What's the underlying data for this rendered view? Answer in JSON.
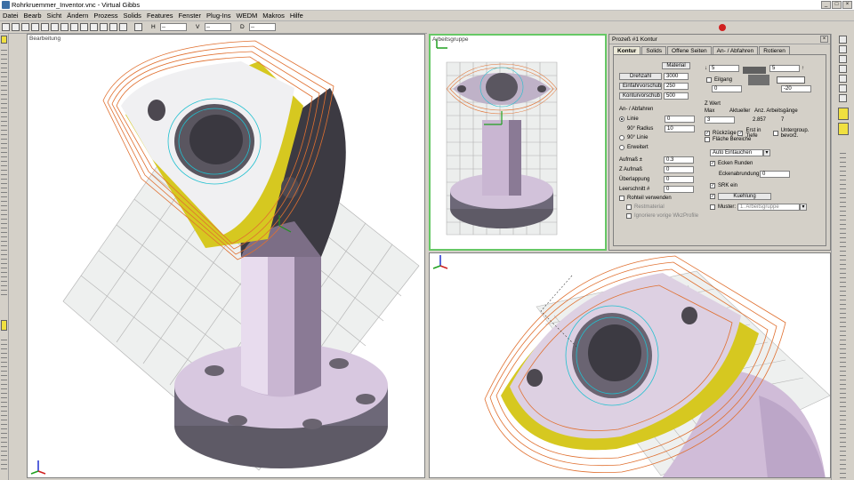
{
  "window": {
    "title": "Rohrkruemmer_Inventor.vnc - Virtual Gibbs"
  },
  "menu": [
    "Datei",
    "Bearb",
    "Sicht",
    "Ändern",
    "Prozess",
    "Solids",
    "Features",
    "Fenster",
    "Plug-Ins",
    "WEDM",
    "Makros",
    "Hilfe"
  ],
  "toolbar": {
    "coords": [
      {
        "label": "H",
        "value": "--"
      },
      {
        "label": "V",
        "value": "--"
      },
      {
        "label": "D",
        "value": "--"
      }
    ]
  },
  "viewports": {
    "main": {
      "title": "Bearbeitung"
    },
    "topright": {
      "title": "Arbeitsgruppe"
    },
    "bottomright": {
      "title": ""
    }
  },
  "dialog": {
    "title": "Prozeß #1 Kontur",
    "tabs": [
      "Kontur",
      "Solids",
      "Offene Seiten",
      "An- / Abfahren",
      "Rotieren"
    ],
    "material_button": "Material",
    "rows": [
      {
        "button": "Drehzahl",
        "value": "3000"
      },
      {
        "button": "Einfahrvorschub",
        "value": "250"
      },
      {
        "button": "Konturvorschub",
        "value": "500"
      }
    ],
    "depth_top": "5",
    "depth_top2": "5",
    "eilgang_label": "Eilgang",
    "depth_bottom": "0",
    "depth_bottom2": "-20",
    "eilgang2_value": "0",
    "an_abfahren": {
      "label": "An- / Abfahren",
      "options": [
        {
          "label": "Linie",
          "value": "0",
          "selected": true
        },
        {
          "label": "90° Radius",
          "value": "10",
          "selected": false
        },
        {
          "label": "90° Linie",
          "value": "",
          "selected": false
        },
        {
          "label": "Erweitert",
          "value": "",
          "selected": false
        }
      ]
    },
    "zwert": {
      "label": "Z Wert",
      "cols": [
        "Max",
        "Aktueller",
        "Anz. Arbeitsgänge"
      ],
      "values": [
        "3",
        "2.857",
        "7"
      ],
      "checks": [
        {
          "label": "Rückzüge",
          "checked": true
        },
        {
          "label": "Erst in Tiefe",
          "checked": true
        },
        {
          "label": "Untergroup. bevorz.",
          "checked": false
        },
        {
          "label": "Fläche Bereiche",
          "checked": false
        }
      ]
    },
    "left_fields": [
      {
        "label": "Aufmaß ±",
        "value": "0.3"
      },
      {
        "label": "Z Aufmaß",
        "value": "0"
      },
      {
        "label": "Überlappung",
        "value": "0"
      },
      {
        "label": "Leerschnitt #",
        "value": "0"
      }
    ],
    "rohteil_label": "Rohteil verwenden",
    "restmaterial_label": "Restmaterial",
    "ignoriere_label": "Ignoriere vorige WkzProfile",
    "eintauchen": "Auto Eintauchen",
    "ecken_runden": {
      "label": "Ecken Runden",
      "checked": true
    },
    "eckenabrundung": {
      "label": "Eckenabrundung",
      "value": "0"
    },
    "srk": {
      "label": "SRK ein",
      "checked": true
    },
    "kuehlung": {
      "label": "Kuehlung",
      "checked": true
    },
    "muster": {
      "label": "Muster:",
      "value": "1. Arbeitsgruppe"
    }
  }
}
